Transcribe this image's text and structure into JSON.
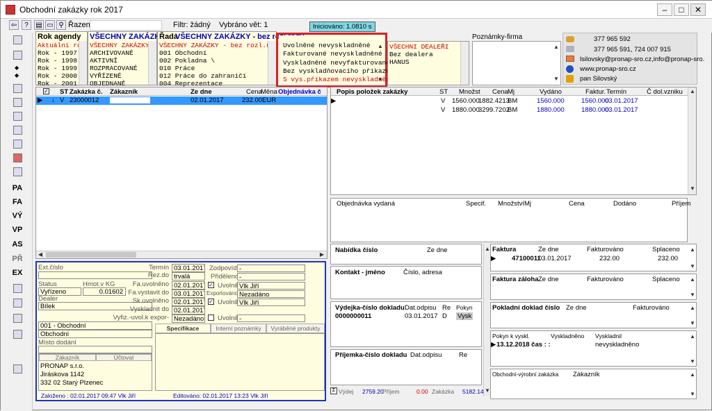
{
  "window": {
    "title": "Obchodní zakázky rok 2017",
    "minimize": "–",
    "maximize": "□",
    "close": "✕"
  },
  "toolbar": {
    "sort_label": "Řazení:",
    "filter_label": "Filtr: žádný",
    "selected_label": "Vybráno vět: 1",
    "init_badge": "Iniciováno: 1.0810 s"
  },
  "left_toolbar": [
    "PA",
    "FA",
    "VÝ",
    "VP",
    "AS",
    "PŘ",
    "EX"
  ],
  "rok_agendy": {
    "header": "Rok agendy",
    "items": [
      "Aktuální rok",
      "Rok - 1997",
      "Rok - 1998",
      "Rok - 1999",
      "Rok - 2000",
      "Rok - 2001"
    ]
  },
  "zakazky": {
    "header": "VŠECHNY ZAKÁZKY",
    "items": [
      "VŠECHNY ZAKÁZKY",
      "ARCHIVOVANÉ",
      "AKTIVNÍ",
      "ROZPRACOVANÉ",
      "VYŘÍZENÉ",
      "OBJEDNANÉ"
    ]
  },
  "rada": {
    "header_prefix": "Řada",
    "header": "VŠECHNY ZAKÁZKY - bez rozl.řady",
    "items": [
      "VŠECHNY ZAKÁZKY - bez rozl.řady",
      "001  Obchodní",
      "002  Pokladna \\",
      "010  Práce",
      "012  Práce do zahraničí",
      "004  Reprezentace"
    ]
  },
  "stav": {
    "items": [
      "Uvolněné nevyskladněné",
      "Fakturované nevyskladněné",
      "Vyskladněné nevyfakturované",
      "Bez vyskladňovacího příkazu",
      "S vys.příkazem nevyskladněné"
    ]
  },
  "dealer": {
    "items": [
      "VŠECHNI DEALEŘI",
      "Bez dealera",
      "",
      "",
      "",
      "HANUS"
    ]
  },
  "poznamky": {
    "header": "Poznámky-firma"
  },
  "contact": {
    "phone1": "377 965 592",
    "phone2": "377 965 591, 724 007 915",
    "email": "lsilovsky@pronap-sro.cz,info@pronap-sro.",
    "web": "www.pronap-sro.cz",
    "person": "pan Silovský"
  },
  "orders": {
    "headers": [
      "ST",
      "Zakázka č.",
      "Zákazník",
      "Ze dne",
      "Cena",
      "Měna",
      "Objednávka č"
    ],
    "rows": [
      {
        "st": "V",
        "cislo": "23000012",
        "zakaznik": "",
        "datum": "02.01.2017",
        "cena": "232.00",
        "mena": "EUR"
      }
    ]
  },
  "items": {
    "headers": [
      "Popis položek zakázky",
      "ST",
      "Množst",
      "Cena",
      "Mj",
      "Vydáno",
      "Faktur.",
      "Termín",
      "Č dol.vzniku"
    ],
    "rows": [
      {
        "st": "V",
        "mnozstvi": "1560.000",
        "cena": "1882.4213",
        "mj": "BM",
        "vydano": "1560.000",
        "faktur": "1560.000",
        "termin": "03.01.2017"
      },
      {
        "st": "V",
        "mnozstvi": "1880.000",
        "cena": "3299.7202",
        "mj": "BM",
        "vydano": "1880.000",
        "faktur": "1880.000",
        "termin": "03.01.2017"
      }
    ]
  },
  "objednavka": {
    "headers": [
      "Objednávka vydaná",
      "Specif.",
      "Množství",
      "Mj",
      "Cena",
      "Dodáno",
      "Příjem"
    ]
  },
  "nabidka": {
    "headers": [
      "Nabídka číslo",
      "Ze dne"
    ]
  },
  "kontakt": {
    "headers": [
      "Kontakt - jméno",
      "Číslo, adresa"
    ]
  },
  "vydejka": {
    "headers": [
      "Výdejka-číslo dokladu",
      "Dat.odpisu",
      "Re",
      "Pokyn"
    ],
    "row": {
      "cislo": "0000000011",
      "datum": "03.01.2017",
      "re": "D",
      "pokyn": "Vysk"
    }
  },
  "prijemka": {
    "headers": [
      "Příjemka-číslo dokladu",
      "Dat.odpisu",
      "Re"
    ]
  },
  "faktura": {
    "headers": [
      "Faktura",
      "Ze dne",
      "Fakturováno",
      "Splaceno"
    ],
    "row": {
      "cislo": "47100011",
      "datum": "03.01.2017",
      "fakturovano": "232.00",
      "splaceno": "232.00"
    }
  },
  "faktura_zaloha": {
    "headers": [
      "Faktura záloha",
      "Ze dne",
      "Fakturováno",
      "Splaceno"
    ]
  },
  "pokladni": {
    "headers": [
      "Pokladní doklad číslo",
      "Ze dne",
      "Fakturováno"
    ]
  },
  "pokyn": {
    "headers": [
      "Pokyn k vyskl.",
      "Vyskladněno",
      "Vyskladnil"
    ],
    "row": {
      "datum": "13.12.2018 čas : :",
      "stav": "nevyskladněno"
    }
  },
  "vyrobni": {
    "headers": [
      "Obchodní-výrobní zakázka",
      "Zákazník"
    ]
  },
  "totals": {
    "vydej_label": "Výdej",
    "vydej": "2759.20",
    "prijem_label": "Příjem",
    "prijem": "0.00",
    "zakazka_label": "Zakázka",
    "zakazka": "5182.14"
  },
  "detail": {
    "ext_cislo_label": "Ext.číslo",
    "status_label": "Status",
    "status": "Vyřízeno",
    "hmot_label": "Hmot.v KG",
    "hmot": "0.01602",
    "dealer_label": "Dealer",
    "dealer": "Bílek",
    "rada": "001 - Obchodní",
    "rada2": "Obchodní",
    "misto_label": "Místo dodání",
    "termin_label": "Termín",
    "termin": "03.01.2017",
    "rezdo_label": "Rez.do",
    "rezdo": "trvalá",
    "fauvol_label": "Fa.uvolněno",
    "fauvol": "02.01.2017",
    "favyst_label": "Fa.vystavit do",
    "favyst": "03.01.2017",
    "skuvol_label": "Sk.uvolněno",
    "skuvol": "02.01.2017",
    "vysk_label": "Vyskladnit do",
    "vysk": "02.01.2017",
    "vyfiz_label": "Vyfiz.-uvol.k expor-",
    "vyfiz": "Nezadáno",
    "zodp_label": "Zodpovídá",
    "zodp": "-",
    "prid_label": "Přiděleno",
    "prid": "-",
    "uvolnil_label": "Uvolnil",
    "uvolnil": "Vlk Jiří",
    "export_label": "Exportováno",
    "export": "Nezadáno",
    "uvolnil2": "Vlk Jiří",
    "uvolnil3": "-",
    "tab_spec": "Specifikace",
    "tab_interni": "Interní poznámky",
    "tab_vyrob": "Vyráběné produkty",
    "tab_zakaznik": "Zákazník",
    "tab_uctovat": "Účtovat",
    "firma": "PRONAP s.r.o.",
    "ulice": "Jiráskova 1142",
    "mesto": "332 02   Starý Plzenec",
    "zalozeno": "Založeno :  02.01.2017 09:47 Vlk Jiří",
    "editovano": "Editováno:  02.01.2017 13:23 Vlk Jiří"
  }
}
